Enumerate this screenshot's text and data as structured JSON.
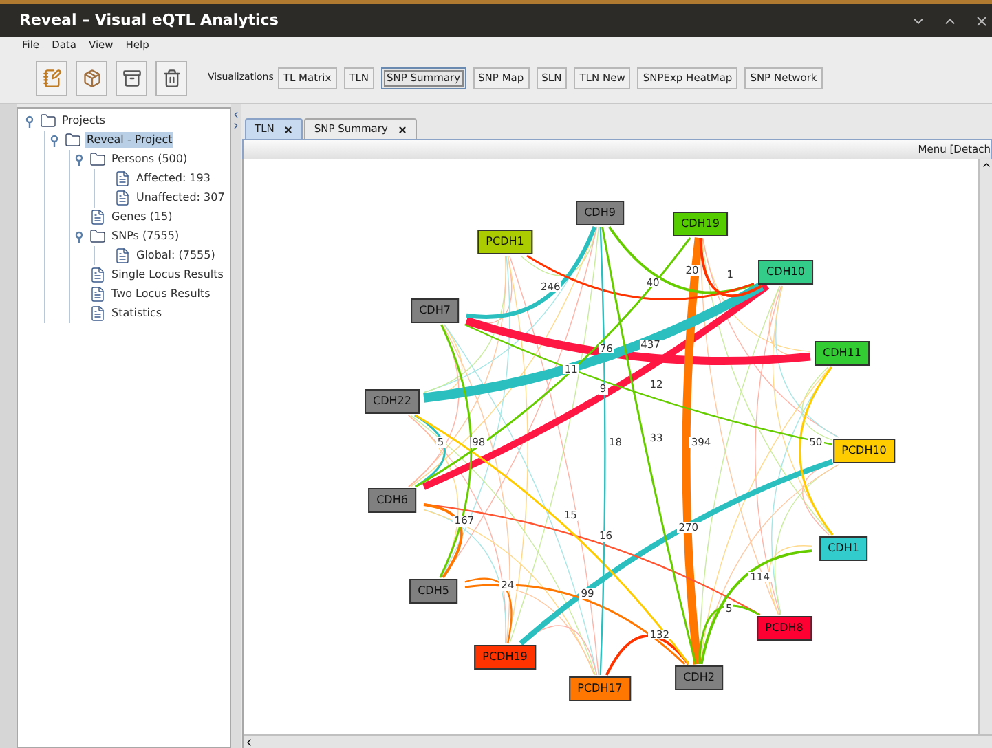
{
  "window": {
    "title": "Reveal – Visual eQTL Analytics"
  },
  "menu": [
    "File",
    "Data",
    "View",
    "Help"
  ],
  "toolbar": {
    "label": "Visualizations",
    "buttons": [
      {
        "label": "TL Matrix",
        "selected": false
      },
      {
        "label": "TLN",
        "selected": false
      },
      {
        "label": "SNP Summary",
        "selected": true
      },
      {
        "label": "SNP Map",
        "selected": false
      },
      {
        "label": "SLN",
        "selected": false
      },
      {
        "label": "TLN New",
        "selected": false
      },
      {
        "label": "SNPExp HeatMap",
        "selected": false
      },
      {
        "label": "SNP Network",
        "selected": false
      }
    ]
  },
  "tree": [
    {
      "label": "Projects",
      "kind": "folder",
      "selected": false,
      "expanded": true,
      "children": [
        {
          "label": "Reveal - Project",
          "kind": "folder",
          "selected": true,
          "expanded": true,
          "children": [
            {
              "label": "Persons (500)",
              "kind": "folder",
              "selected": false,
              "expanded": true,
              "children": [
                {
                  "label": "Affected: 193",
                  "kind": "document",
                  "selected": false
                },
                {
                  "label": "Unaffected: 307",
                  "kind": "document",
                  "selected": false
                }
              ]
            },
            {
              "label": "Genes (15)",
              "kind": "document",
              "selected": false
            },
            {
              "label": "SNPs (7555)",
              "kind": "folder",
              "selected": false,
              "expanded": true,
              "children": [
                {
                  "label": "Global: (7555)",
                  "kind": "document",
                  "selected": false
                }
              ]
            },
            {
              "label": "Single Locus Results",
              "kind": "document",
              "selected": false
            },
            {
              "label": "Two Locus Results",
              "kind": "document",
              "selected": false
            },
            {
              "label": "Statistics",
              "kind": "document",
              "selected": false
            }
          ]
        }
      ]
    }
  ],
  "tabs": [
    {
      "label": "TLN",
      "selected": true
    },
    {
      "label": "SNP Summary",
      "selected": false
    }
  ],
  "panel_menu": "Menu [Detach",
  "network": {
    "nodes": [
      {
        "label": "CDH9",
        "color": "#808080"
      },
      {
        "label": "CDH19",
        "color": "#55cc00"
      },
      {
        "label": "PCDH1",
        "color": "#aacc00"
      },
      {
        "label": "CDH10",
        "color": "#33cc88"
      },
      {
        "label": "CDH7",
        "color": "#808080"
      },
      {
        "label": "CDH11",
        "color": "#33cc33"
      },
      {
        "label": "CDH22",
        "color": "#808080"
      },
      {
        "label": "PCDH10",
        "color": "#ffcc00"
      },
      {
        "label": "CDH6",
        "color": "#808080"
      },
      {
        "label": "CDH1",
        "color": "#33cccc"
      },
      {
        "label": "CDH5",
        "color": "#808080"
      },
      {
        "label": "PCDH8",
        "color": "#ff0033"
      },
      {
        "label": "PCDH19",
        "color": "#ff3300"
      },
      {
        "label": "CDH2",
        "color": "#808080"
      },
      {
        "label": "PCDH17",
        "color": "#ff7700"
      }
    ],
    "edge_labels": [
      "437",
      "9",
      "394",
      "76",
      "270",
      "246",
      "20",
      "1",
      "40",
      "99",
      "16",
      "132",
      "24",
      "5",
      "114",
      "167",
      "33",
      "5",
      "98",
      "50",
      "12",
      "15",
      "18",
      "11"
    ]
  }
}
